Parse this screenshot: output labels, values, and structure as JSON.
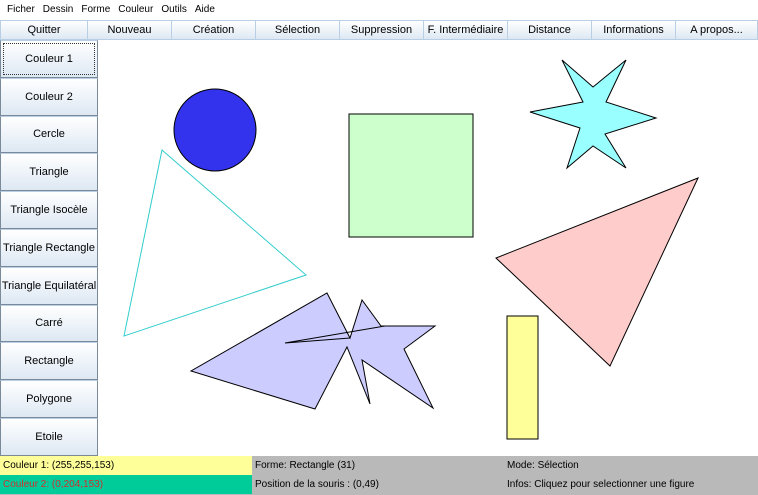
{
  "menu": {
    "items": [
      "Ficher",
      "Dessin",
      "Forme",
      "Couleur",
      "Outils",
      "Aide"
    ]
  },
  "toolbar": {
    "buttons": [
      "Quitter",
      "Nouveau",
      "Création",
      "Sélection",
      "Suppression",
      "F. Intermédiaire",
      "Distance",
      "Informations",
      "A propos..."
    ]
  },
  "sidebar": {
    "buttons": [
      "Couleur 1",
      "Couleur 2",
      "Cercle",
      "Triangle",
      "Triangle Isocèle",
      "Triangle Rectangle",
      "Triangle Equilatéral",
      "Carré",
      "Rectangle",
      "Polygone",
      "Etoile"
    ]
  },
  "status": {
    "color1_label": "Couleur 1: (255,255,153)",
    "color2_label": "Couleur 2: (0,204,153)",
    "shape_label": "Forme: Rectangle (31)",
    "mouse_label": "Position de la souris : (0,49)",
    "mode_label": "Mode: Sélection",
    "info_label": "Infos: Cliquez pour selectionner une figure"
  },
  "colors": {
    "color1": "#ffff99",
    "color2": "#00cc99",
    "status_bg": "#b9b9b9",
    "circle_fill": "#3333ee",
    "square_fill": "#ccffcc",
    "star_fill": "#99ffff",
    "big_triangle_fill": "#ffcccc",
    "polygon_fill": "#ccccff",
    "rectangle_fill": "#ffff99",
    "outline_triangle_stroke": "#33cccc"
  }
}
